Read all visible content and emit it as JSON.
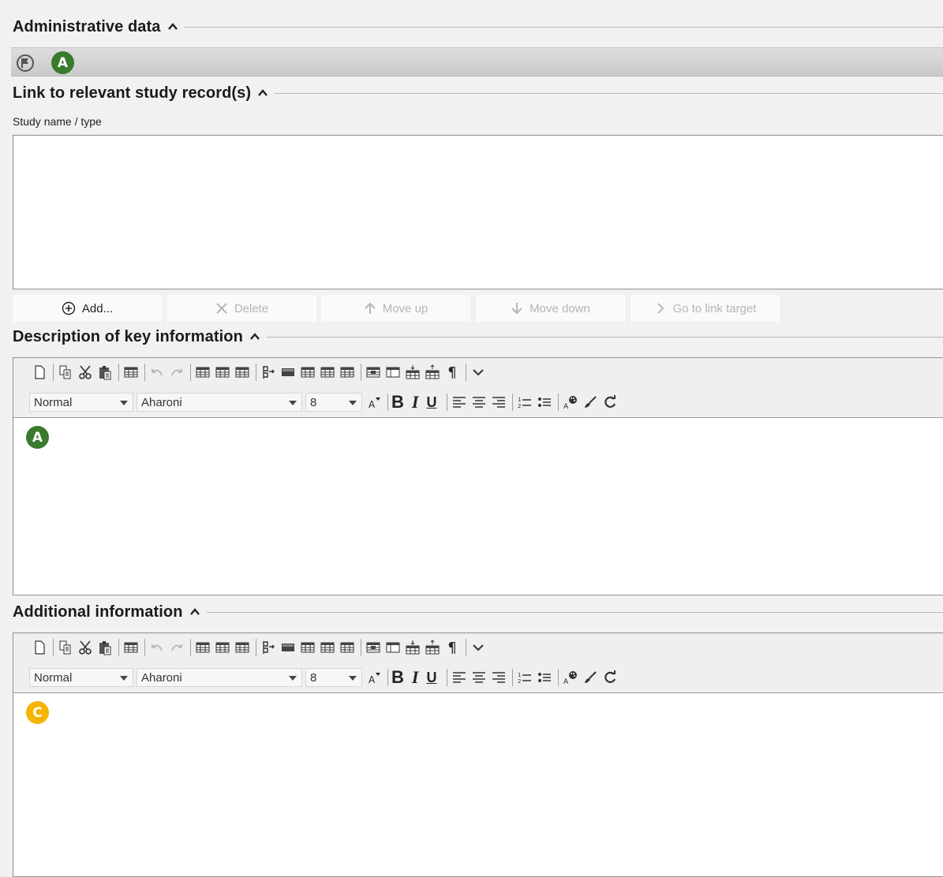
{
  "sections": {
    "administrative": {
      "title": "Administrative data",
      "badge": "A"
    },
    "link": {
      "title": "Link to relevant study record(s)",
      "field_label": "Study name / type",
      "buttons": {
        "add": "Add...",
        "delete": "Delete",
        "move_up": "Move up",
        "move_down": "Move down",
        "go_to_link": "Go to link target"
      }
    },
    "description": {
      "title": "Description of key information",
      "style_value": "Normal",
      "font_value": "Aharoni",
      "size_value": "8",
      "badge": "A"
    },
    "additional": {
      "title": "Additional information",
      "style_value": "Normal",
      "font_value": "Aharoni",
      "size_value": "8",
      "badge": "C"
    }
  },
  "icons": [
    "flag-icon",
    "new-document-icon",
    "copy-icon",
    "cut-icon",
    "paste-icon",
    "table-icon",
    "undo-icon",
    "redo-icon",
    "table-insert-icon",
    "table-merge-icon",
    "table-split-icon",
    "indent-table-icon",
    "pilcrow-icon",
    "expand-toolbar-icon",
    "font-size-icon",
    "bold-icon",
    "italic-icon",
    "underline-icon",
    "align-left-icon",
    "align-center-icon",
    "align-right-icon",
    "numbered-list-icon",
    "bullet-list-icon",
    "text-color-icon",
    "clear-format-icon",
    "refresh-icon"
  ],
  "colors": {
    "badge_green": "#3a7a2e",
    "badge_yellow": "#f4b400"
  }
}
